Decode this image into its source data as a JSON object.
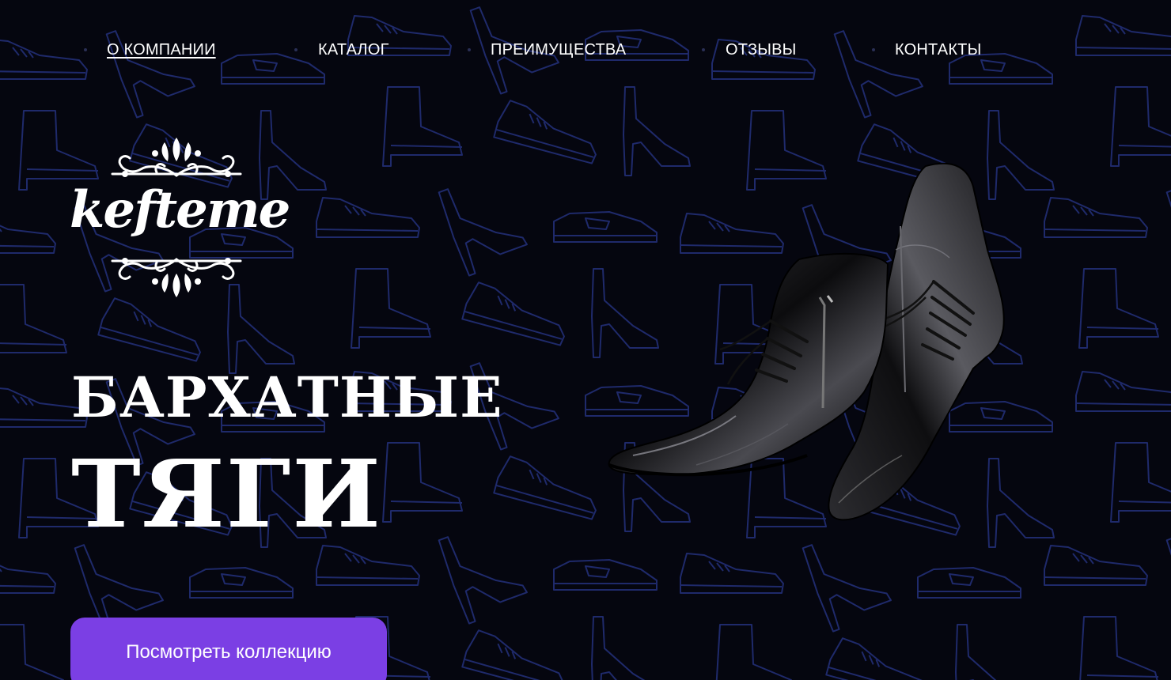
{
  "nav": {
    "items": [
      {
        "label": "О КОМПАНИИ",
        "active": true
      },
      {
        "label": "КАТАЛОГ",
        "active": false
      },
      {
        "label": "ПРЕИМУЩЕСТВА",
        "active": false
      },
      {
        "label": "ОТЗЫВЫ",
        "active": false
      },
      {
        "label": "КОНТАКТЫ",
        "active": false
      }
    ]
  },
  "brand": {
    "logo_text": "kefteme"
  },
  "hero": {
    "headline_line1": "БАРХАТНЫЕ",
    "headline_line2": "ТЯГИ",
    "cta_label": "Посмотреть коллекцию"
  },
  "colors": {
    "background": "#05060f",
    "pattern_stroke": "#1f2a6b",
    "accent": "#7b3fe4",
    "text": "#ffffff"
  },
  "icons": {
    "background_pattern": "shoe-outline-pattern",
    "logo_ornaments": "flourish-ornament",
    "product": "black-leather-boots"
  }
}
